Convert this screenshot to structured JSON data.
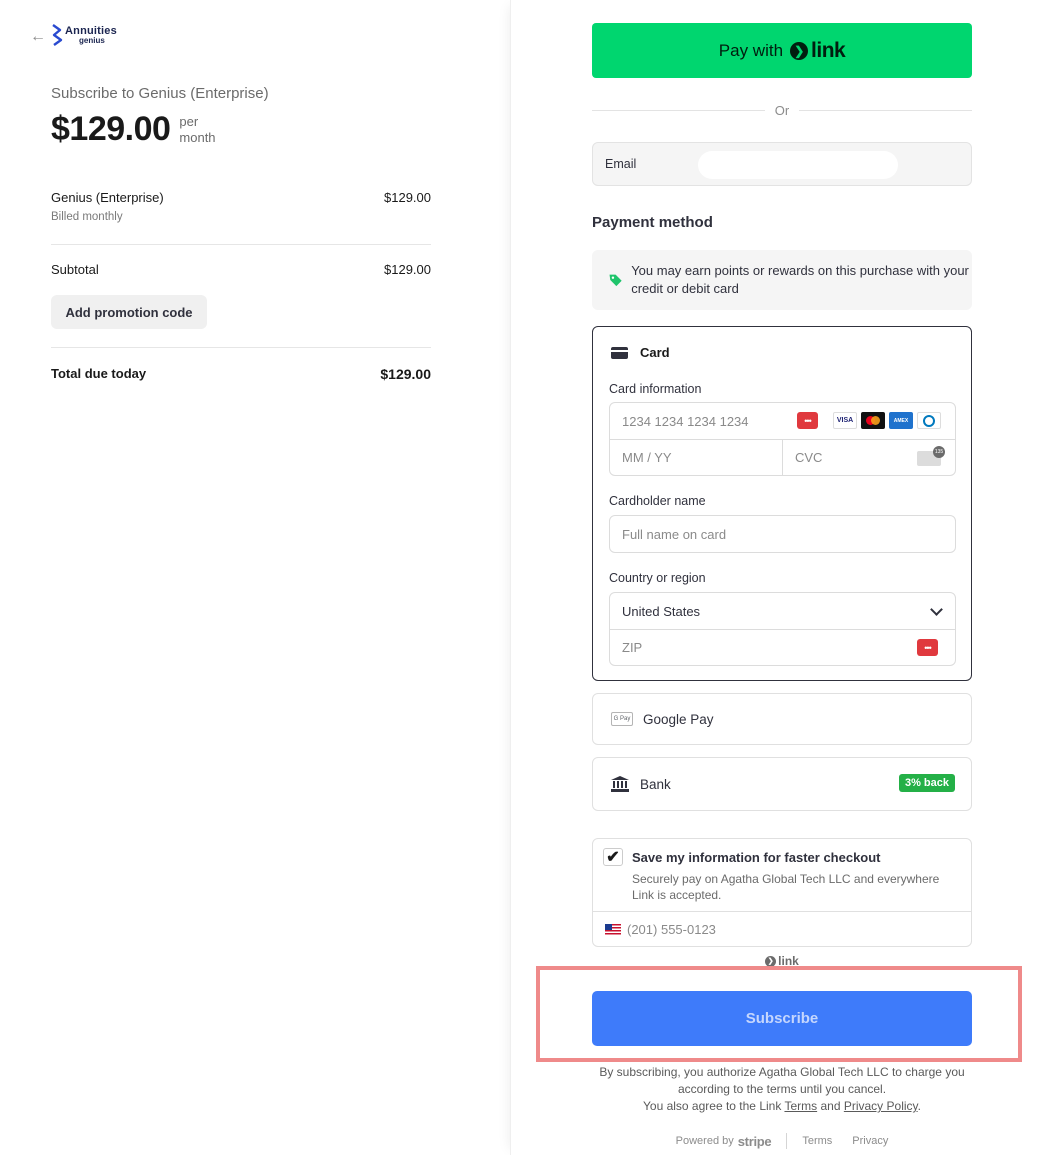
{
  "merchant": {
    "logo_main": "Annuities",
    "logo_sub": "genius"
  },
  "summary": {
    "title": "Subscribe to Genius (Enterprise)",
    "price": "$129.00",
    "period": "per month",
    "line_item": {
      "name": "Genius (Enterprise)",
      "sub": "Billed monthly",
      "price": "$129.00"
    },
    "subtotal_label": "Subtotal",
    "subtotal_value": "$129.00",
    "promo_label": "Add promotion code",
    "total_label": "Total due today",
    "total_value": "$129.00"
  },
  "checkout": {
    "link_button_prefix": "Pay with",
    "link_word": "link",
    "or_text": "Or",
    "email_label": "Email",
    "payment_method_title": "Payment method",
    "rewards_text": "You may earn points or rewards on this purchase with your credit or debit card",
    "card": {
      "header": "Card",
      "card_info_label": "Card information",
      "card_number_placeholder": "1234 1234 1234 1234",
      "expiry_placeholder": "MM / YY",
      "cvc_placeholder": "CVC",
      "cardholder_label": "Cardholder name",
      "cardholder_placeholder": "Full name on card",
      "country_label": "Country or region",
      "country_value": "United States",
      "zip_placeholder": "ZIP",
      "brands": [
        "VISA",
        "mastercard",
        "AMEX",
        "Diners"
      ],
      "cvc_icon_text": "135"
    },
    "google_pay_label": "Google Pay",
    "google_pay_icon_text": "G Pay",
    "bank_label": "Bank",
    "bank_badge": "3% back",
    "save": {
      "checked": true,
      "title": "Save my information for faster checkout",
      "description": "Securely pay on Agatha Global Tech LLC and everywhere Link is accepted.",
      "phone_placeholder": "(201) 555-0123"
    },
    "link_small": "link",
    "subscribe_label": "Subscribe",
    "legal_line1": "By subscribing, you authorize Agatha Global Tech LLC to charge you according to the terms until you cancel.",
    "legal_line2_prefix": "You also agree to the Link",
    "legal_terms": "Terms",
    "legal_and": "and",
    "legal_privacy": "Privacy Policy",
    "legal_end": ".",
    "footer_powered": "Powered by",
    "footer_stripe": "stripe",
    "footer_terms": "Terms",
    "footer_privacy": "Privacy"
  },
  "colors": {
    "link_green": "#00d66f",
    "subscribe_blue": "#3e7bfa",
    "badge_green": "#24b047",
    "highlight": "#ef8a8a"
  }
}
